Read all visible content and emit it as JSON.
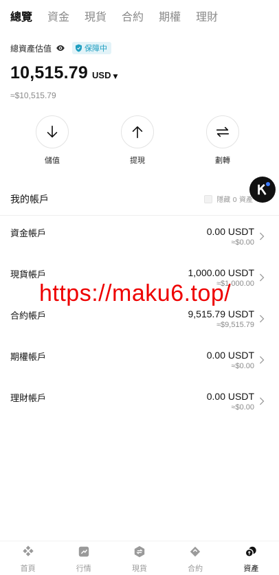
{
  "tabs": [
    {
      "label": "總覽",
      "active": true
    },
    {
      "label": "資金",
      "active": false
    },
    {
      "label": "現貨",
      "active": false
    },
    {
      "label": "合約",
      "active": false
    },
    {
      "label": "期權",
      "active": false
    },
    {
      "label": "理財",
      "active": false
    }
  ],
  "estimate": {
    "label": "總資產估值",
    "protected_label": "保障中",
    "balance": "10,515.79",
    "currency": "USD",
    "approx": "≈$10,515.79"
  },
  "actions": [
    {
      "label": "儲值",
      "icon": "arrow-down-icon"
    },
    {
      "label": "提現",
      "icon": "arrow-up-icon"
    },
    {
      "label": "劃轉",
      "icon": "transfer-icon"
    }
  ],
  "accounts_section": {
    "title": "我的帳戶",
    "hide_small_label": "隱藏 0 資產"
  },
  "accounts": [
    {
      "name": "資金帳戶",
      "amount": "0.00 USDT",
      "usd": "≈$0.00"
    },
    {
      "name": "現貨帳戶",
      "amount": "1,000.00 USDT",
      "usd": "≈$1,000.00"
    },
    {
      "name": "合約帳戶",
      "amount": "9,515.79 USDT",
      "usd": "≈$9,515.79"
    },
    {
      "name": "期權帳戶",
      "amount": "0.00 USDT",
      "usd": "≈$0.00"
    },
    {
      "name": "理財帳戶",
      "amount": "0.00 USDT",
      "usd": "≈$0.00"
    }
  ],
  "watermark": "https://maku6.top/",
  "bottom_nav": [
    {
      "label": "首頁",
      "icon": "home-icon"
    },
    {
      "label": "行情",
      "icon": "market-icon"
    },
    {
      "label": "現貨",
      "icon": "spot-icon"
    },
    {
      "label": "合約",
      "icon": "futures-icon"
    },
    {
      "label": "資產",
      "icon": "assets-icon",
      "active": true
    }
  ],
  "colors": {
    "accent_protect": "#1e9ec0",
    "watermark": "#ee0000",
    "muted": "#8a8a8a"
  }
}
